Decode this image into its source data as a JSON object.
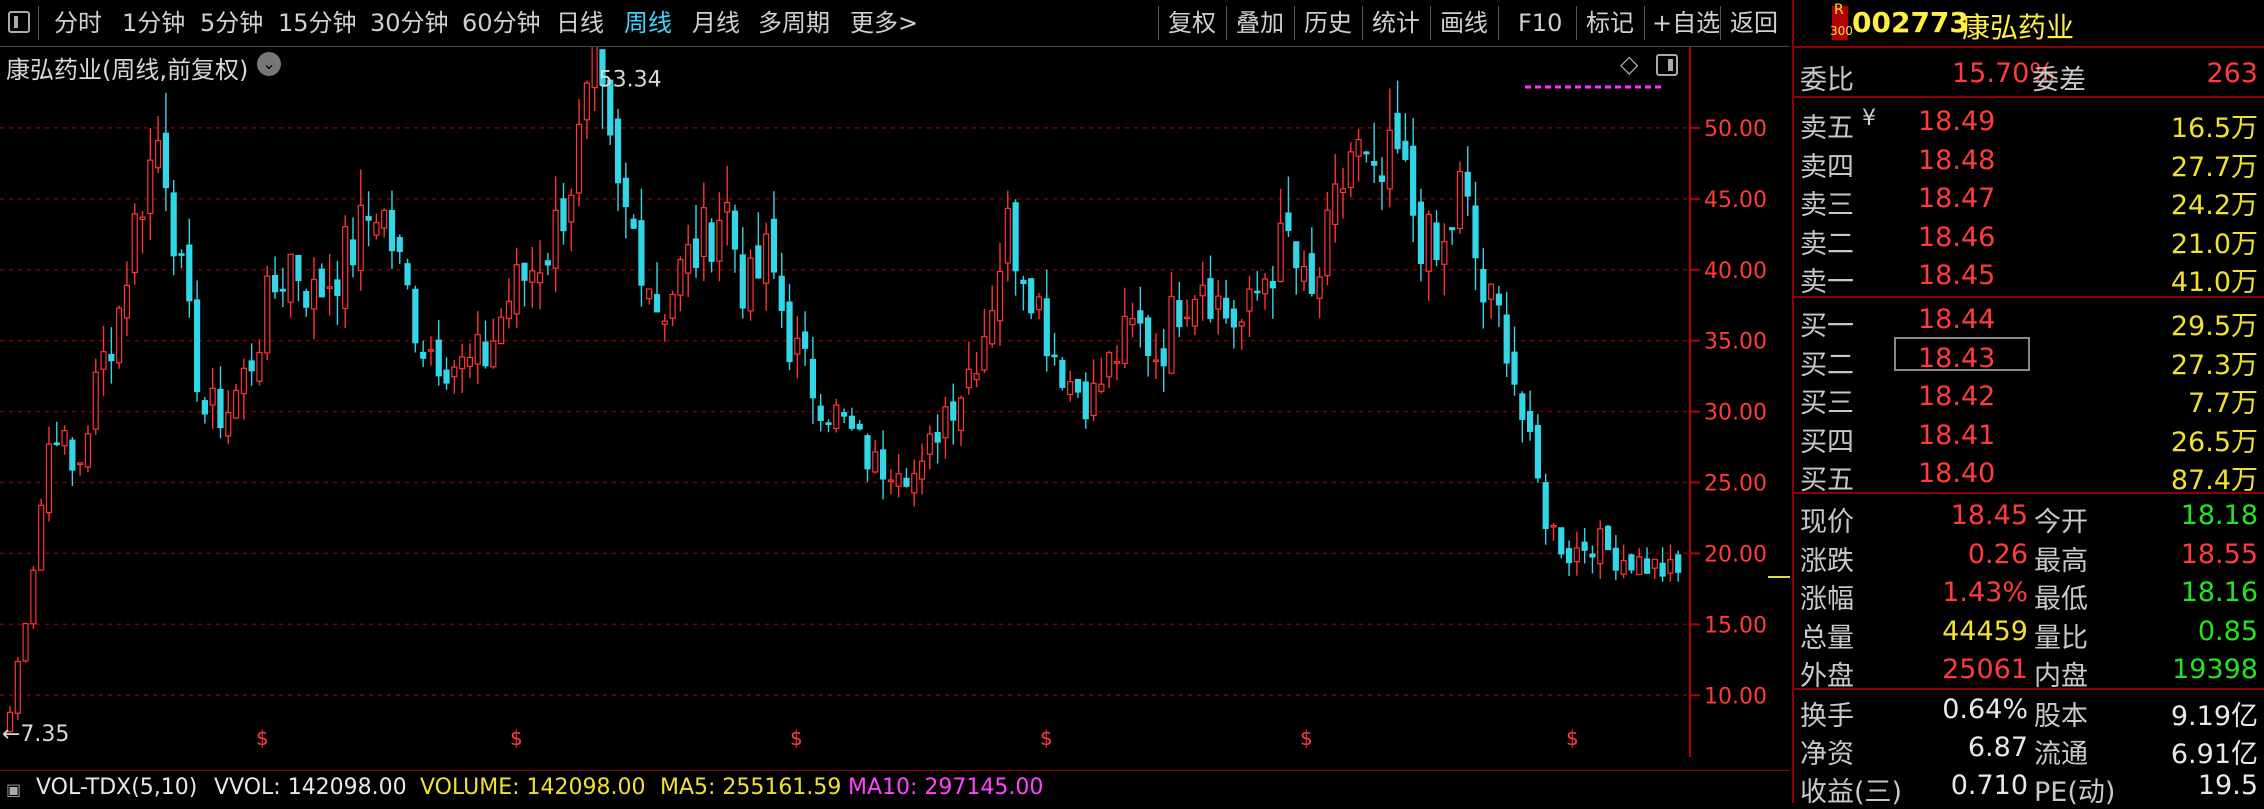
{
  "toolbar": {
    "periods": [
      "分时",
      "1分钟",
      "5分钟",
      "15分钟",
      "30分钟",
      "60分钟",
      "日线",
      "周线",
      "月线",
      "多周期",
      "更多>"
    ],
    "active_period": "周线",
    "actions": [
      "复权",
      "叠加",
      "历史",
      "统计",
      "画线",
      "F10",
      "标记",
      "+自选",
      "返回"
    ]
  },
  "chart": {
    "title": "康弘药业(周线,前复权)",
    "high_label": "53.34",
    "low_label": "←7.35",
    "split_marker": "$"
  },
  "chart_data": {
    "type": "candlestick",
    "x": "weeks",
    "ylim": [
      6,
      55
    ],
    "y_ticks": [
      10.0,
      15.0,
      20.0,
      25.0,
      30.0,
      35.0,
      40.0,
      45.0,
      50.0
    ],
    "grid": true,
    "max_price": 53.34,
    "min_price": 7.35,
    "close_trend": [
      8.8,
      18.5,
      30,
      25,
      32,
      37,
      45,
      50,
      38,
      30,
      30,
      33,
      38,
      41,
      38,
      40,
      42,
      45,
      40,
      35,
      34,
      33,
      34,
      38,
      40,
      42,
      47,
      53.34,
      45,
      42,
      37,
      40,
      42,
      45,
      38,
      41,
      35,
      32,
      30,
      28,
      26,
      27,
      25,
      30,
      32,
      36,
      43,
      40,
      35,
      32,
      31,
      34,
      36,
      34,
      38,
      40,
      37,
      36,
      40,
      42,
      37,
      43,
      49,
      45,
      48,
      43,
      40,
      46,
      38,
      36,
      28,
      22,
      20,
      21,
      20,
      19.5,
      19,
      18.45
    ],
    "colors": {
      "up": "#ff3333",
      "down": "#33d6e6",
      "grid": "#7a0000",
      "axis": "#b00000"
    }
  },
  "volume": {
    "name": "VOL-TDX(5,10)",
    "vvol": "VVOL: 142098.00",
    "volume": "VOLUME: 142098.00",
    "ma5": "MA5: 255161.59",
    "ma10": "MA10: 297145.00"
  },
  "panel": {
    "stock_code": "002773",
    "stock_name": "康弘药业",
    "badge_top": "R",
    "badge_bottom": "300",
    "weibi_label": "委比",
    "weibi_value": "15.70%",
    "weicha_label": "委差",
    "weicha_value": "263",
    "sell": [
      {
        "label": "卖五",
        "price": "18.49",
        "volume": "16.5万"
      },
      {
        "label": "卖四",
        "price": "18.48",
        "volume": "27.7万"
      },
      {
        "label": "卖三",
        "price": "18.47",
        "volume": "24.2万"
      },
      {
        "label": "卖二",
        "price": "18.46",
        "volume": "21.0万"
      },
      {
        "label": "卖一",
        "price": "18.45",
        "volume": "41.0万"
      }
    ],
    "buy": [
      {
        "label": "买一",
        "price": "18.44",
        "volume": "29.5万"
      },
      {
        "label": "买二",
        "price": "18.43",
        "volume": "27.3万"
      },
      {
        "label": "买三",
        "price": "18.42",
        "volume": "7.7万"
      },
      {
        "label": "买四",
        "price": "18.41",
        "volume": "26.5万"
      },
      {
        "label": "买五",
        "price": "18.40",
        "volume": "87.4万"
      }
    ],
    "yen_mark": "¥",
    "stats": [
      {
        "l1": "现价",
        "v1": "18.45",
        "l2": "今开",
        "v2": "18.18"
      },
      {
        "l1": "涨跌",
        "v1": "0.26",
        "l2": "最高",
        "v2": "18.55"
      },
      {
        "l1": "涨幅",
        "v1": "1.43%",
        "l2": "最低",
        "v2": "18.16"
      },
      {
        "l1": "总量",
        "v1": "44459",
        "l2": "量比",
        "v2": "0.85"
      },
      {
        "l1": "外盘",
        "v1": "25061",
        "l2": "内盘",
        "v2": "19398"
      }
    ],
    "stats2": [
      {
        "l1": "换手",
        "v1": "0.64%",
        "l2": "股本",
        "v2": "9.19亿"
      },
      {
        "l1": "净资",
        "v1": "6.87",
        "l2": "流通",
        "v2": "6.91亿"
      },
      {
        "l1": "收益(三)",
        "v1": "0.710",
        "l2": "PE(动)",
        "v2": "19.5"
      }
    ]
  }
}
